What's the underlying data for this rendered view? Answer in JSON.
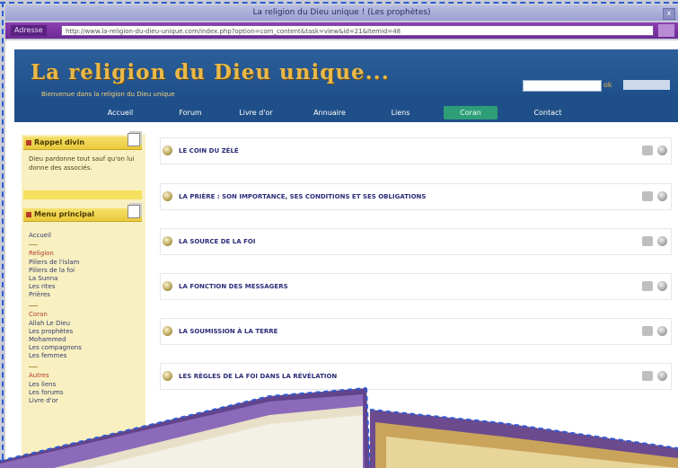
{
  "window": {
    "title": "La religion du Dieu unique ! (Les prophètes)",
    "close_glyph": "x"
  },
  "addressbar": {
    "label": "Adresse",
    "url": "http://www.la-religion-du-dieu-unique.com/index.php?option=com_content&task=view&id=21&Itemid=48"
  },
  "site": {
    "title": "La religion du Dieu unique...",
    "subtitle": "Bienvenue dans la religion du Dieu unique",
    "search_button": "ok"
  },
  "nav": {
    "items": [
      "Accueil",
      "Forum",
      "Livre d'or",
      "Annuaire",
      "Liens",
      "Coran",
      "Contact"
    ],
    "active_index": 5
  },
  "sidebar": {
    "box1_title": "Rappel divin",
    "box1_text": "Dieu pardonne tout sauf qu'on lui donne des associés.",
    "box2_title": "Menu principal",
    "menu_top": "Accueil",
    "group1_title": "Religion",
    "group1_items": [
      "Piliers de l'islam",
      "Piliers de la foi",
      "La Sunna",
      "Les rites",
      "Prières"
    ],
    "group2_title": "Coran",
    "group2_items": [
      "Allah Le Dieu",
      "Les prophètes",
      "Mohammed",
      "Les compagnons",
      "Les femmes"
    ],
    "group3_title": "Autres",
    "group3_items": [
      "Les liens",
      "Les forums",
      "Livre d'or"
    ]
  },
  "content": {
    "rows": [
      "LE COIN DU ZÉLÉ",
      "LA PRIÈRE : SON IMPORTANCE, SES CONDITIONS ET SES OBLIGATIONS",
      "LA SOURCE DE LA FOI",
      "LA FONCTION DES MESSAGERS",
      "LA SOUMISSION À LA TERRE",
      "LES RÈGLES DE LA FOI DANS LA RÉVÉLATION"
    ]
  },
  "colors": {
    "accent_dashed": "#2e5bd6",
    "header_bg": "#1f4f88",
    "title_gold": "#e8b94a",
    "active_nav": "#2e9e77",
    "sidebar_bg": "#f8f0c0"
  }
}
